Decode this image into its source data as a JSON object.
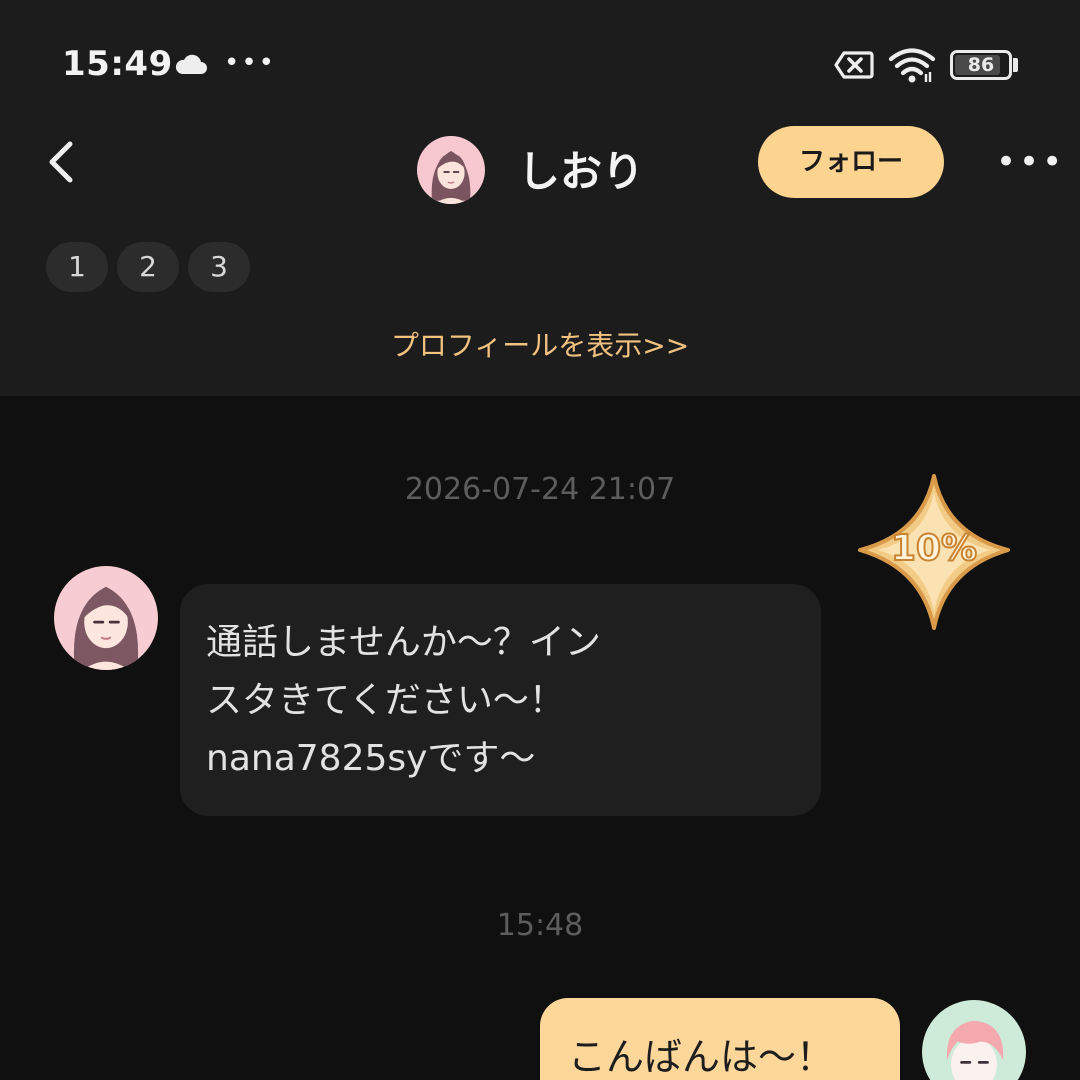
{
  "status_bar": {
    "time": "15:49",
    "icons": [
      "cloud-icon",
      "more-dots-icon",
      "sim-off-icon",
      "wifi-icon"
    ],
    "battery": "86",
    "battery_level": 0.86
  },
  "header": {
    "contact_name": "しおり",
    "follow_label": "フォロー",
    "back_icon": "chevron-left-icon",
    "more_icon": "more-horizontal-icon"
  },
  "tags": [
    "1",
    "2",
    "3"
  ],
  "profile_link": "プロフィールを表示>>",
  "messages": [
    {
      "timestamp": "2026-07-24 21:07",
      "direction": "incoming",
      "lines": [
        "通話しませんか〜？イン",
        "スタきてください〜！",
        "nana7825syです〜"
      ]
    },
    {
      "timestamp": "15:48",
      "direction": "outgoing",
      "text": "こんばんは〜！"
    }
  ],
  "badge": {
    "text": "10%"
  },
  "colors": {
    "accent": "#fcd38f",
    "link": "#f2c27f",
    "header_bg": "#1c1c1c",
    "chat_bg": "#101010",
    "bubble_in": "#1f1f1f",
    "bubble_out": "#fdd79a"
  }
}
